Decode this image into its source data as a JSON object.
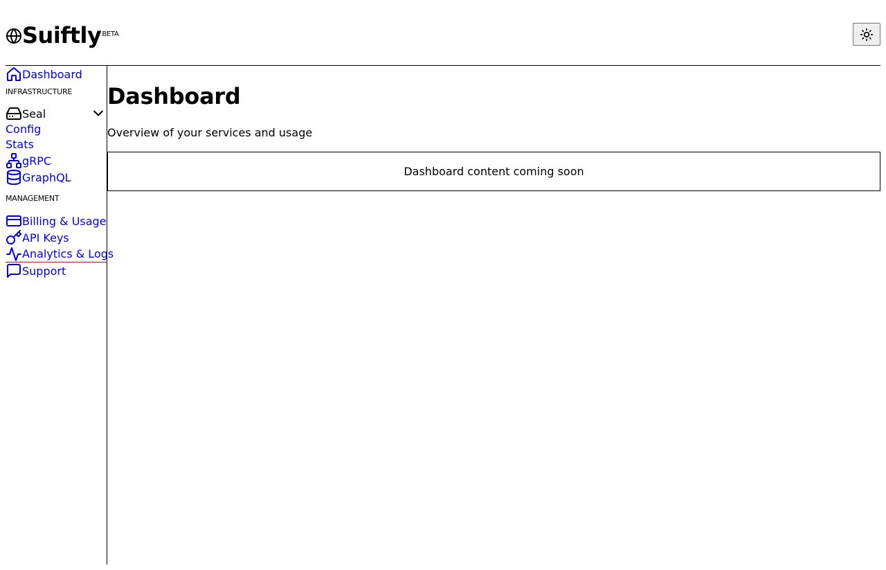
{
  "brand": {
    "name": "Suiftly",
    "badge": "BETA",
    "logo_icon": "globe-icon"
  },
  "header": {
    "theme_toggle_icon": "sun-icon"
  },
  "sidebar": {
    "dashboard_label": "Dashboard",
    "infrastructure_label": "INFRASTRUCTURE",
    "seal": {
      "label": "Seal",
      "config_label": "Config",
      "stats_label": "Stats"
    },
    "grpc_label": "gRPC",
    "graphql_label": "GraphQL",
    "management_label": "MANAGEMENT",
    "billing_label": "Billing & Usage",
    "api_keys_label": "API Keys",
    "analytics_label": "Analytics & Logs",
    "support_label": "Support"
  },
  "main": {
    "title": "Dashboard",
    "subtitle": "Overview of your services and usage",
    "placeholder_text": "Dashboard content coming soon"
  },
  "colors": {
    "link": "#0000ee",
    "active_underline": "#e00000"
  }
}
